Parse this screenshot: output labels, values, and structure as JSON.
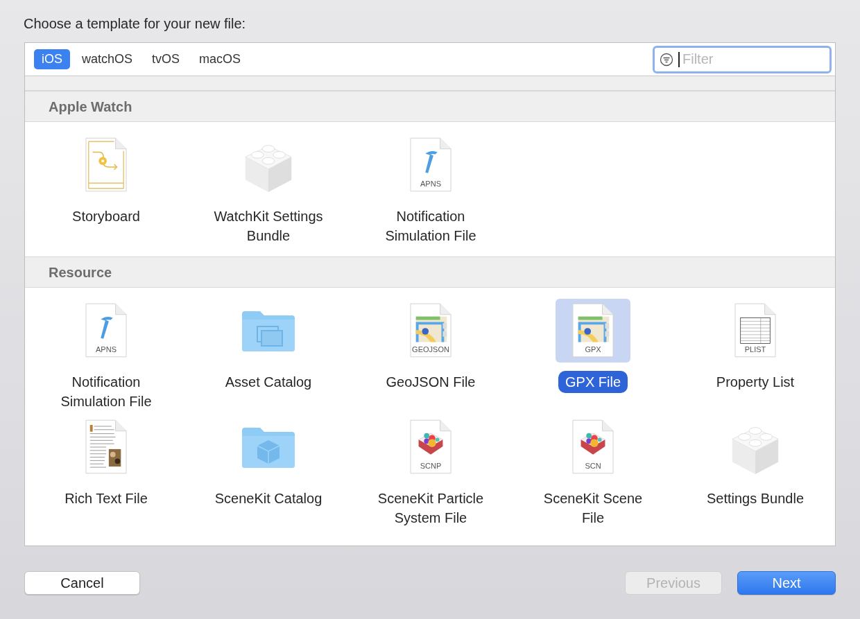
{
  "prompt": "Choose a template for your new file:",
  "tabs": [
    {
      "label": "iOS",
      "selected": true
    },
    {
      "label": "watchOS",
      "selected": false
    },
    {
      "label": "tvOS",
      "selected": false
    },
    {
      "label": "macOS",
      "selected": false
    }
  ],
  "filter": {
    "placeholder": "Filter"
  },
  "sections": [
    {
      "title": "Apple Watch",
      "items": [
        {
          "label": "Storyboard",
          "kind": "storyboard",
          "selected": false
        },
        {
          "label": "WatchKit Settings Bundle",
          "kind": "bundle",
          "selected": false
        },
        {
          "label": "Notification Simulation File",
          "kind": "document",
          "badge": "APNS",
          "selected": false
        }
      ]
    },
    {
      "title": "Resource",
      "items": [
        {
          "label": "Notification Simulation File",
          "kind": "document",
          "badge": "APNS",
          "selected": false
        },
        {
          "label": "Asset Catalog",
          "kind": "folder",
          "selected": false
        },
        {
          "label": "GeoJSON File",
          "kind": "document",
          "badge": "GEOJSON",
          "selected": false
        },
        {
          "label": "GPX File",
          "kind": "document",
          "badge": "GPX",
          "selected": true
        },
        {
          "label": "Property List",
          "kind": "document",
          "badge": "PLIST",
          "selected": false
        },
        {
          "label": "Rich Text File",
          "kind": "document",
          "selected": false
        },
        {
          "label": "SceneKit Catalog",
          "kind": "folder",
          "selected": false
        },
        {
          "label": "SceneKit Particle System File",
          "kind": "document",
          "badge": "SCNP",
          "selected": false
        },
        {
          "label": "SceneKit Scene File",
          "kind": "document",
          "badge": "SCN",
          "selected": false
        },
        {
          "label": "Settings Bundle",
          "kind": "bundle",
          "selected": false
        }
      ]
    }
  ],
  "buttons": [
    {
      "label": "Cancel",
      "kind": "normal",
      "disabled": false
    },
    {
      "label": "Previous",
      "kind": "normal",
      "disabled": true
    },
    {
      "label": "Next",
      "kind": "default",
      "disabled": false
    }
  ]
}
